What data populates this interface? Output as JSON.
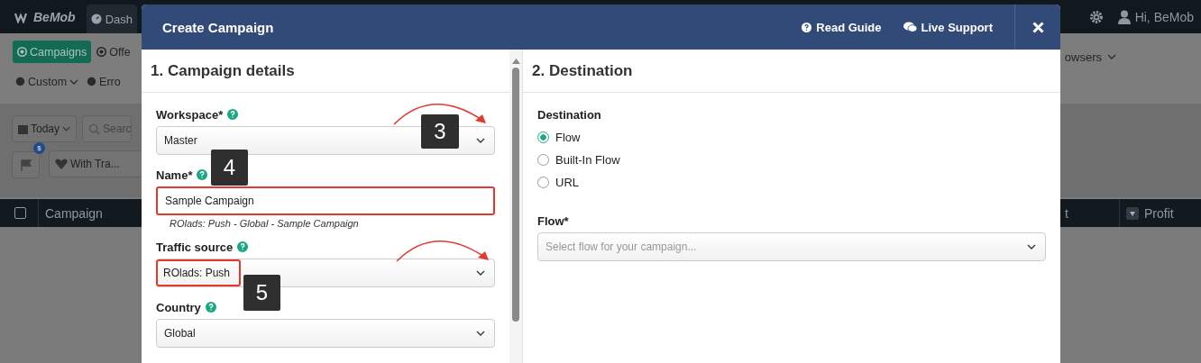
{
  "app_bar": {
    "logo": "BeMob",
    "tab": "Dash",
    "user": "Hi, BeMob"
  },
  "nav": {
    "row_1": [
      {
        "label": "Campaigns",
        "selected": true
      },
      {
        "label": "Offe",
        "selected": false
      }
    ],
    "row_2": [
      {
        "label": "Custom",
        "kind": "dropdown"
      },
      {
        "label": "Erro",
        "kind": "link"
      }
    ],
    "right": "owsers"
  },
  "filters": {
    "date": "Today",
    "search_placeholder": "Searc",
    "badge": "$",
    "traffic": "With Tra..."
  },
  "table": {
    "checked": false,
    "columns": [
      "Campaign",
      "t",
      "Profit"
    ]
  },
  "modal": {
    "title": "Create Campaign",
    "links": [
      {
        "label": "Read Guide",
        "kind": "guide"
      },
      {
        "label": "Live Support",
        "kind": "chat"
      }
    ],
    "details": {
      "title": "1. Campaign details",
      "fields": [
        {
          "label": "Workspace*",
          "help": true,
          "kind": "select",
          "value": "Master",
          "highlighted": false
        },
        {
          "label": "Name*",
          "help": true,
          "kind": "input",
          "value": "Sample Campaign",
          "highlighted": true,
          "hint": "ROlads: Push - Global - Sample Campaign"
        },
        {
          "label": "Traffic source",
          "help": true,
          "kind": "select",
          "value": "ROlads: Push",
          "highlighted": true
        },
        {
          "label": "Country",
          "help": true,
          "kind": "select",
          "value": "Global",
          "highlighted": false
        }
      ]
    },
    "destination": {
      "title": "2. Destination",
      "label": "Destination",
      "options": [
        {
          "label": "Flow",
          "selected": true
        },
        {
          "label": "Built-In Flow",
          "selected": false
        },
        {
          "label": "URL",
          "selected": false
        }
      ],
      "flow": {
        "label": "Flow*",
        "placeholder": "Select flow for your campaign..."
      }
    }
  },
  "annotations": [
    {
      "label": "3"
    },
    {
      "label": "4"
    },
    {
      "label": "5"
    }
  ]
}
